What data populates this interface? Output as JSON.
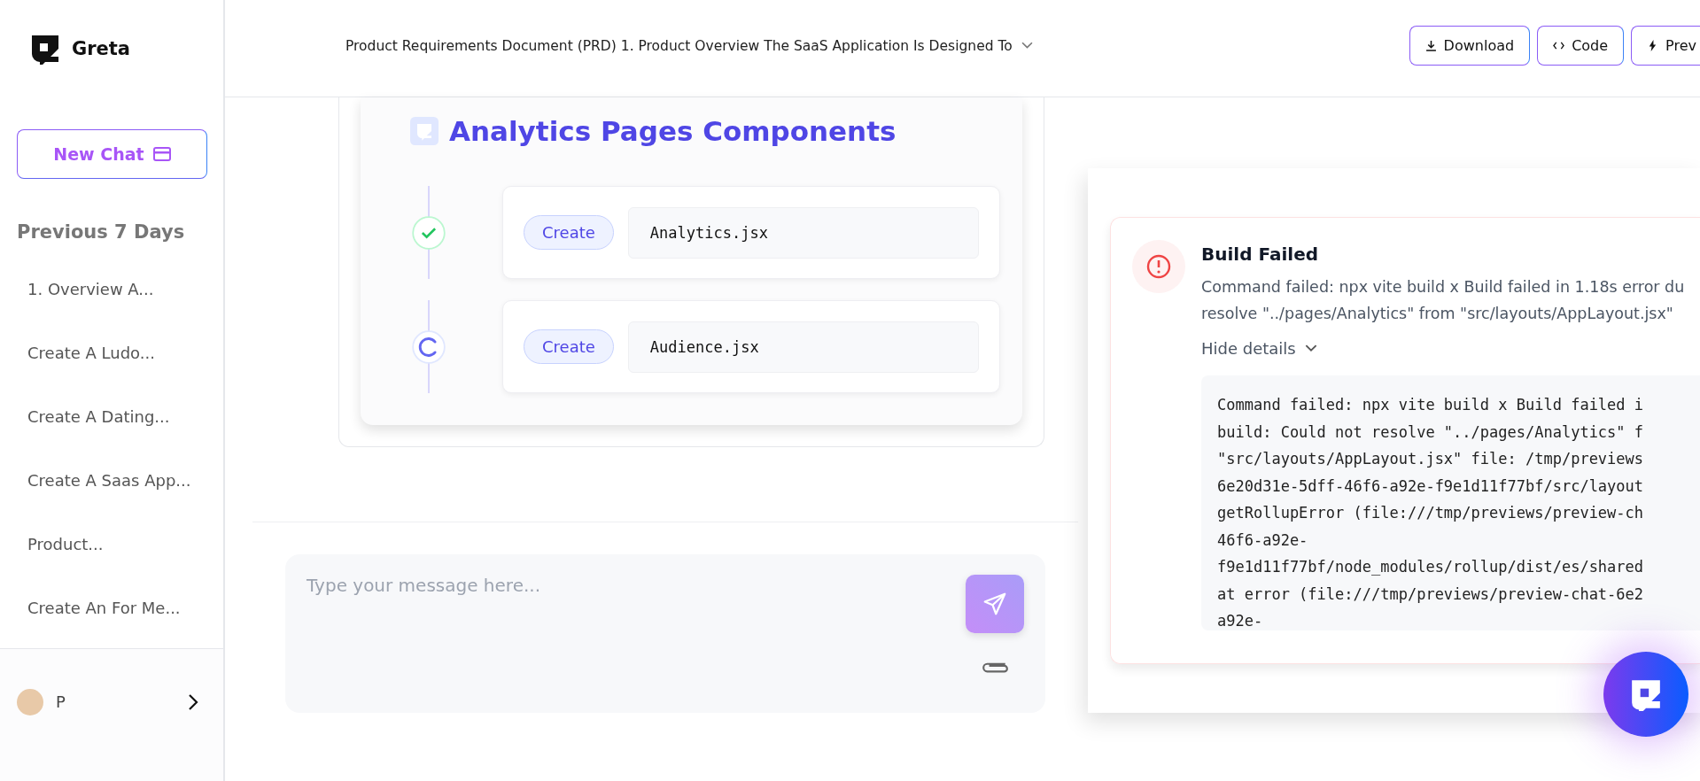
{
  "brand": {
    "name": "Greta"
  },
  "header": {
    "title": "Product Requirements Document (PRD) 1. Product Overview The SaaS Application Is Designed To",
    "buttons": [
      {
        "label": "Download",
        "kind": "download"
      },
      {
        "label": "Code",
        "kind": "code"
      },
      {
        "label": "Prev",
        "kind": "preview"
      }
    ]
  },
  "sidebar": {
    "new_chat": "New Chat",
    "section": "Previous 7 Days",
    "items": [
      "1. Overview A...",
      "Create A Ludo...",
      "Create A Dating...",
      "Create A Saas App...",
      "Product...",
      "Create An For Me..."
    ],
    "user": "P"
  },
  "task_card": {
    "title": "Analytics Pages Components",
    "steps": [
      {
        "action": "Create",
        "file": "Analytics.jsx",
        "done": true
      },
      {
        "action": "Create",
        "file": "Audience.jsx",
        "done": false
      }
    ]
  },
  "composer": {
    "placeholder": "Type your message here..."
  },
  "error": {
    "title": "Build Failed",
    "message": [
      "Command failed: npx vite build x Build failed in 1.18s error du",
      "resolve \"../pages/Analytics\" from \"src/layouts/AppLayout.jsx\""
    ],
    "toggle": "Hide details",
    "details": [
      "Command failed: npx vite build x Build failed i",
      "build: Could not resolve \"../pages/Analytics\" f",
      "\"src/layouts/AppLayout.jsx\" file: /tmp/previews",
      "6e20d31e-5dff-46f6-a92e-f9e1d11f77bf/src/layout",
      "getRollupError (file:///tmp/previews/preview-ch",
      "46f6-a92e-",
      "f9e1d11f77bf/node_modules/rollup/dist/es/shared",
      "at error (file:///tmp/previews/preview-chat-6e2",
      "a92e-"
    ]
  }
}
